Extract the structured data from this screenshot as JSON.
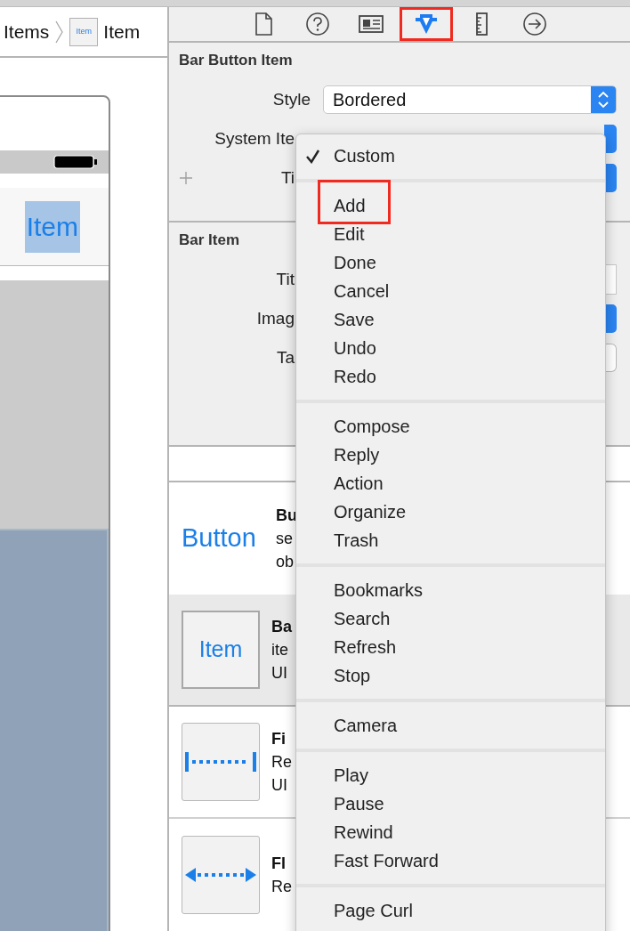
{
  "breadcrumb": {
    "items": [
      {
        "kind": "text",
        "label": "Items"
      },
      {
        "kind": "item",
        "icon_text": "Item",
        "label": "Item"
      }
    ]
  },
  "canvas": {
    "nav_item": {
      "label": "Item",
      "selected": true
    }
  },
  "inspector_tabs": [
    {
      "kind": "file",
      "selected": false,
      "highlighted": false
    },
    {
      "kind": "help",
      "selected": false,
      "highlighted": false
    },
    {
      "kind": "identity",
      "selected": false,
      "highlighted": false
    },
    {
      "kind": "attributes",
      "selected": true,
      "highlighted": true
    },
    {
      "kind": "size",
      "selected": false,
      "highlighted": false
    },
    {
      "kind": "connections",
      "selected": false,
      "highlighted": false
    }
  ],
  "sections": [
    {
      "title": "Bar Button Item",
      "rows": [
        {
          "kind": "popup",
          "label": "Style",
          "value": "Bordered"
        },
        {
          "kind": "popup_covered",
          "label": "System Ite"
        },
        {
          "kind": "popup_covered",
          "label": "Ti",
          "addable": true
        }
      ]
    },
    {
      "title": "Bar Item",
      "rows": [
        {
          "kind": "field_covered",
          "label": "Tit"
        },
        {
          "kind": "popup_covered",
          "label": "Imag"
        },
        {
          "kind": "stepper_covered",
          "label": "Ta"
        }
      ]
    }
  ],
  "library": [
    {
      "kind": "text",
      "preview": "Button",
      "title": "Bu",
      "lines": [
        "se",
        "ob"
      ],
      "selected": false
    },
    {
      "kind": "bar_item",
      "preview": "Item",
      "title": "Ba",
      "lines": [
        "ite",
        "UI"
      ],
      "selected": true
    },
    {
      "kind": "fixed",
      "title": "Fi",
      "lines": [
        "Re",
        "UI"
      ],
      "selected": false
    },
    {
      "kind": "flexible",
      "title": "Fl",
      "lines": [
        "Re"
      ],
      "selected": false
    }
  ],
  "menu": {
    "groups": [
      [
        {
          "label": "Custom",
          "checked": true,
          "highlighted": false
        }
      ],
      [
        {
          "label": "Add",
          "checked": false,
          "highlighted": true
        },
        {
          "label": "Edit",
          "checked": false,
          "highlighted": false
        },
        {
          "label": "Done",
          "checked": false,
          "highlighted": false
        },
        {
          "label": "Cancel",
          "checked": false,
          "highlighted": false
        },
        {
          "label": "Save",
          "checked": false,
          "highlighted": false
        },
        {
          "label": "Undo",
          "checked": false,
          "highlighted": false
        },
        {
          "label": "Redo",
          "checked": false,
          "highlighted": false
        }
      ],
      [
        {
          "label": "Compose",
          "checked": false,
          "highlighted": false
        },
        {
          "label": "Reply",
          "checked": false,
          "highlighted": false
        },
        {
          "label": "Action",
          "checked": false,
          "highlighted": false
        },
        {
          "label": "Organize",
          "checked": false,
          "highlighted": false
        },
        {
          "label": "Trash",
          "checked": false,
          "highlighted": false
        }
      ],
      [
        {
          "label": "Bookmarks",
          "checked": false,
          "highlighted": false
        },
        {
          "label": "Search",
          "checked": false,
          "highlighted": false
        },
        {
          "label": "Refresh",
          "checked": false,
          "highlighted": false
        },
        {
          "label": "Stop",
          "checked": false,
          "highlighted": false
        }
      ],
      [
        {
          "label": "Camera",
          "checked": false,
          "highlighted": false
        }
      ],
      [
        {
          "label": "Play",
          "checked": false,
          "highlighted": false
        },
        {
          "label": "Pause",
          "checked": false,
          "highlighted": false
        },
        {
          "label": "Rewind",
          "checked": false,
          "highlighted": false
        },
        {
          "label": "Fast Forward",
          "checked": false,
          "highlighted": false
        }
      ],
      [
        {
          "label": "Page Curl",
          "checked": false,
          "highlighted": false
        }
      ]
    ]
  }
}
